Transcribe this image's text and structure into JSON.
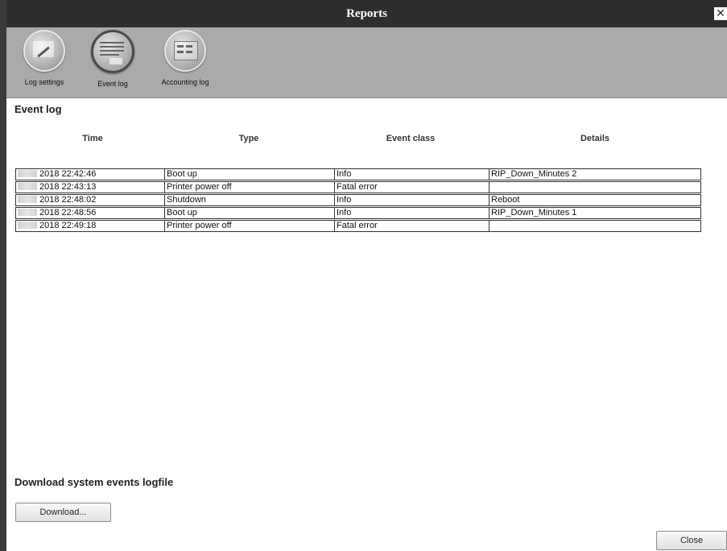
{
  "window": {
    "title": "Reports",
    "close_glyph": "✕"
  },
  "toolbar": {
    "items": [
      {
        "label": "Log settings",
        "icon": "log-settings-icon",
        "active": false
      },
      {
        "label": "Event log",
        "icon": "event-log-icon",
        "active": true
      },
      {
        "label": "Accounting log",
        "icon": "accounting-log-icon",
        "active": false
      }
    ]
  },
  "event_log": {
    "title": "Event log",
    "columns": [
      "Time",
      "Type",
      "Event class",
      "Details"
    ],
    "rows": [
      {
        "time": "2018 22:42:46",
        "type": "Boot up",
        "event_class": "Info",
        "details": "RIP_Down_Minutes 2"
      },
      {
        "time": "2018 22:43:13",
        "type": "Printer power off",
        "event_class": "Fatal error",
        "details": ""
      },
      {
        "time": "2018 22:48:02",
        "type": "Shutdown",
        "event_class": "Info",
        "details": "Reboot"
      },
      {
        "time": "2018 22:48:56",
        "type": "Boot up",
        "event_class": "Info",
        "details": "RIP_Down_Minutes 1"
      },
      {
        "time": "2018 22:49:18",
        "type": "Printer power off",
        "event_class": "Fatal error",
        "details": ""
      }
    ]
  },
  "download": {
    "title": "Download system events logfile",
    "button_label": "Download..."
  },
  "footer": {
    "close_label": "Close"
  },
  "colors": {
    "titlebar": "#2e2e2e",
    "toolbar": "#aaaaaa",
    "border": "#333333"
  }
}
